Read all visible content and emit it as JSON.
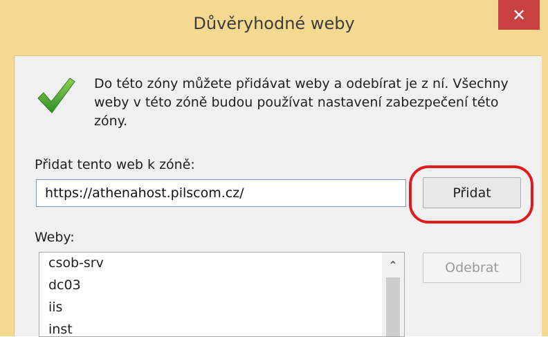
{
  "window": {
    "title": "Důvěryhodné weby",
    "close_glyph": "✕",
    "accent_color": "#f6d990",
    "close_button_color": "#c84040"
  },
  "dialog": {
    "description_lines": [
      "Do této zóny můžete přidávat weby a odebírat je z ní. Všechny",
      "weby v této zóně budou používat nastavení zabezpečení této",
      "zóny."
    ],
    "add_label": "Přidat tento web k zóně:",
    "url_value": "https://athenahost.pilscom.cz/",
    "add_button": "Přidat",
    "sites_label": "Weby:",
    "sites": [
      "csob-srv",
      "dc03",
      "iis",
      "inst"
    ],
    "remove_button": "Odebrat",
    "scroll_up_glyph": "⌃"
  },
  "annotation": {
    "highlight_color": "#e01c1c"
  }
}
